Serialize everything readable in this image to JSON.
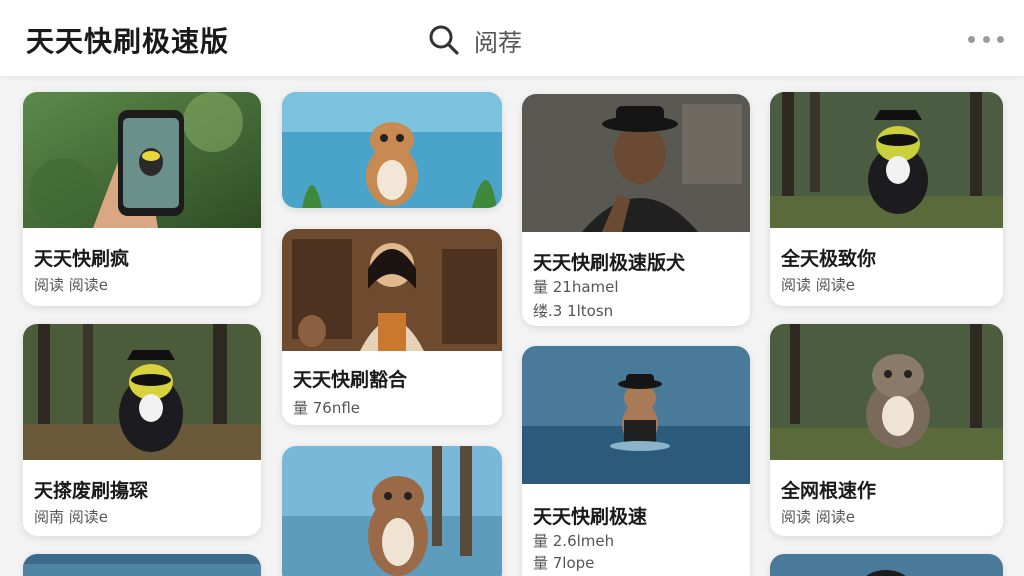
{
  "app": {
    "title": "天天快刷极速版"
  },
  "search": {
    "text": "阅荐"
  },
  "cards": [
    {
      "title": "天天快刷疯",
      "meta": "阅读 阅读e"
    },
    {
      "title": "天搽废刷摥琛",
      "meta": "阅南 阅读e"
    },
    {
      "title": "天天快刷豁合",
      "meta": "量 76nfle"
    },
    {
      "title": "天天快刷极速版犬",
      "meta": "量 21hamel",
      "meta2": "缕.3 1ltosn"
    },
    {
      "title": "天天快刷极速",
      "meta": "量 2.6lmeh",
      "meta2": "量 7lope"
    },
    {
      "title": "全天极致你",
      "meta": "阅读 阅读e"
    },
    {
      "title": "全网根速作",
      "meta": "阅读 阅读e"
    }
  ]
}
